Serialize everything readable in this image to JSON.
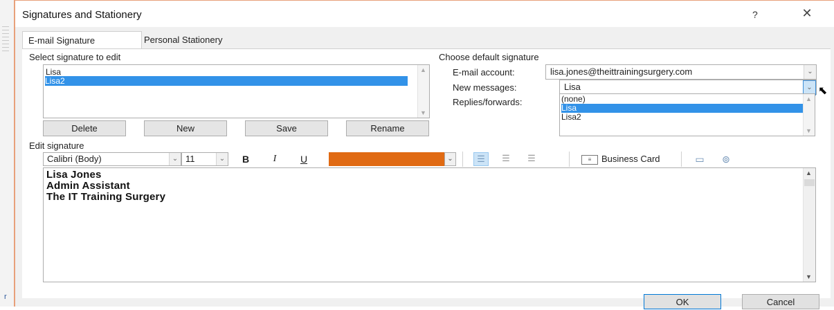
{
  "window": {
    "title": "Signatures and Stationery",
    "help": "?",
    "close": "✕"
  },
  "tabs": [
    {
      "label": "E-mail Signature",
      "active": true
    },
    {
      "label": "Personal Stationery",
      "active": false
    }
  ],
  "select_section": {
    "label": "Select signature to edit",
    "signatures": [
      "Lisa",
      "Lisa2"
    ],
    "selected_index": 1
  },
  "list_buttons": {
    "delete": "Delete",
    "new": "New",
    "save": "Save",
    "rename": "Rename"
  },
  "default_section": {
    "label": "Choose default signature",
    "email_account_label": "E-mail account:",
    "email_account_value": "lisa.jones@theittrainingsurgery.com",
    "new_messages_label": "New messages:",
    "new_messages_value": "Lisa",
    "replies_label": "Replies/forwards:",
    "dropdown_options": [
      "(none)",
      "Lisa",
      "Lisa2"
    ],
    "dropdown_selected_index": 1
  },
  "edit_section": {
    "label": "Edit signature",
    "font": "Calibri (Body)",
    "size": "11",
    "bold": "B",
    "italic": "I",
    "underline": "U",
    "font_color": "#e06a13",
    "business_card": "Business Card",
    "lines": [
      "Lisa Jones",
      "Admin Assistant",
      "The IT Training Surgery"
    ]
  },
  "footer": {
    "ok": "OK",
    "cancel": "Cancel"
  },
  "icons": {
    "dropdown": "chevron-down-icon",
    "picture": "insert-picture-icon",
    "hyperlink": "hyperlink-icon",
    "align_left": "align-left-icon",
    "align_center": "align-center-icon",
    "align_right": "align-right-icon"
  }
}
